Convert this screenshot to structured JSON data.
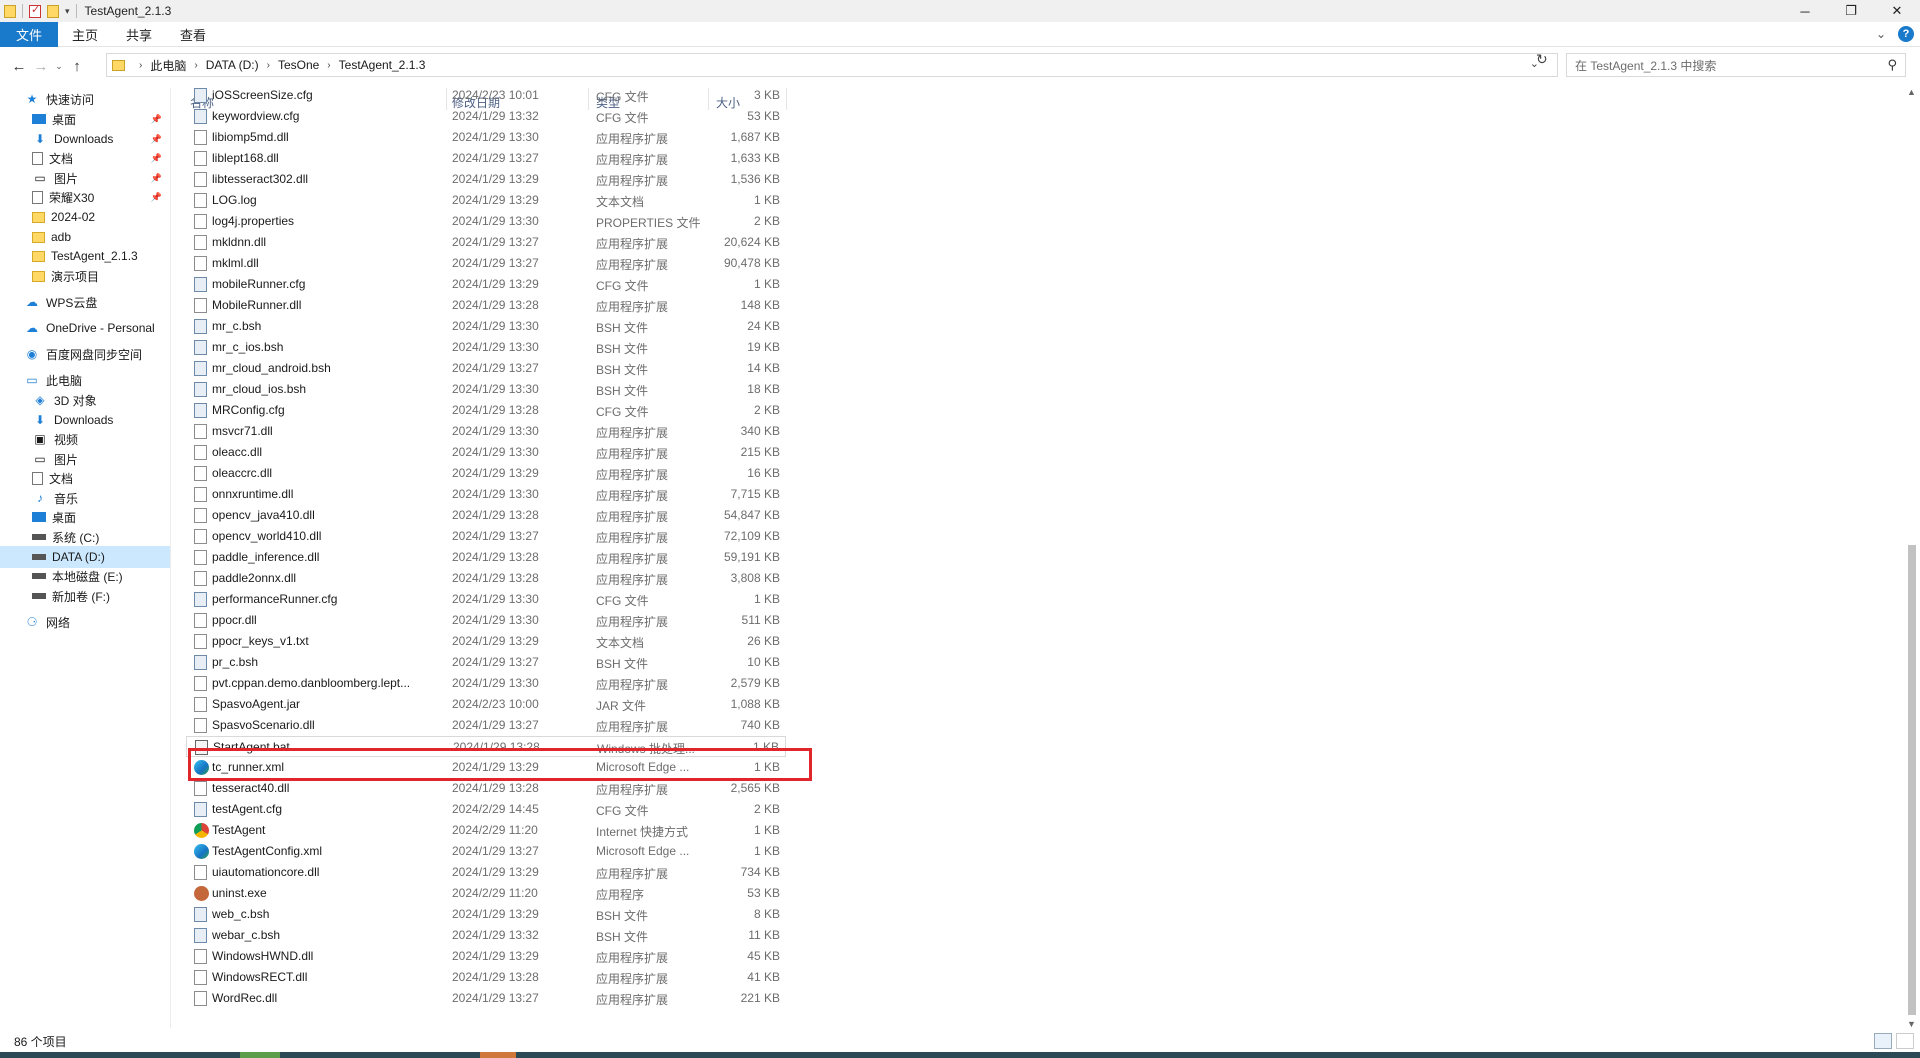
{
  "window": {
    "title": "TestAgent_2.1.3",
    "minimize": "─",
    "maximize": "❐",
    "close": "✕"
  },
  "ribbon": {
    "tabs": [
      "文件",
      "主页",
      "共享",
      "查看"
    ],
    "expand_icon": "chevron-down-icon",
    "help_label": "?"
  },
  "address": {
    "breadcrumbs": [
      "此电脑",
      "DATA (D:)",
      "TesOne",
      "TestAgent_2.1.3"
    ],
    "search_placeholder": "在 TestAgent_2.1.3 中搜索"
  },
  "sidebar": {
    "items": [
      {
        "label": "快速访问",
        "icon": "star-icon",
        "pinned": false
      },
      {
        "label": "桌面",
        "icon": "desktop-icon",
        "pinned": true
      },
      {
        "label": "Downloads",
        "icon": "download-icon",
        "pinned": true
      },
      {
        "label": "文档",
        "icon": "documents-icon",
        "pinned": true
      },
      {
        "label": "图片",
        "icon": "pictures-icon",
        "pinned": true
      },
      {
        "label": "荣耀X30",
        "icon": "phone-icon",
        "pinned": true
      },
      {
        "label": "2024-02",
        "icon": "folder-icon",
        "pinned": false
      },
      {
        "label": "adb",
        "icon": "folder-icon",
        "pinned": false
      },
      {
        "label": "TestAgent_2.1.3",
        "icon": "folder-icon",
        "pinned": false
      },
      {
        "label": "演示项目",
        "icon": "folder-icon",
        "pinned": false
      },
      {
        "label": "WPS云盘",
        "icon": "cloud-icon",
        "pinned": false
      },
      {
        "label": "OneDrive - Personal",
        "icon": "onedrive-icon",
        "pinned": false
      },
      {
        "label": "百度网盘同步空间",
        "icon": "baidu-icon",
        "pinned": false
      },
      {
        "label": "此电脑",
        "icon": "computer-icon",
        "pinned": false
      },
      {
        "label": "3D 对象",
        "icon": "3d-objects-icon",
        "pinned": false
      },
      {
        "label": "Downloads",
        "icon": "download-icon",
        "pinned": false
      },
      {
        "label": "视频",
        "icon": "videos-icon",
        "pinned": false
      },
      {
        "label": "图片",
        "icon": "pictures-icon",
        "pinned": false
      },
      {
        "label": "文档",
        "icon": "documents-icon",
        "pinned": false
      },
      {
        "label": "音乐",
        "icon": "music-icon",
        "pinned": false
      },
      {
        "label": "桌面",
        "icon": "desktop-icon",
        "pinned": false
      },
      {
        "label": "系统 (C:)",
        "icon": "drive-icon",
        "pinned": false
      },
      {
        "label": "DATA (D:)",
        "icon": "drive-icon",
        "pinned": false,
        "selected": true
      },
      {
        "label": "本地磁盘 (E:)",
        "icon": "drive-icon",
        "pinned": false
      },
      {
        "label": "新加卷 (F:)",
        "icon": "drive-icon",
        "pinned": false
      },
      {
        "label": "网络",
        "icon": "network-icon",
        "pinned": false
      }
    ]
  },
  "columns": {
    "name": "名称",
    "date": "修改日期",
    "type": "类型",
    "size": "大小"
  },
  "files": [
    {
      "name": "iOSScreenSize.cfg",
      "date": "2024/2/23 10:01",
      "type": "CFG 文件",
      "size": "3 KB",
      "icon": "cfg"
    },
    {
      "name": "keywordview.cfg",
      "date": "2024/1/29 13:32",
      "type": "CFG 文件",
      "size": "53 KB",
      "icon": "cfg"
    },
    {
      "name": "libiomp5md.dll",
      "date": "2024/1/29 13:30",
      "type": "应用程序扩展",
      "size": "1,687 KB",
      "icon": "file"
    },
    {
      "name": "liblept168.dll",
      "date": "2024/1/29 13:27",
      "type": "应用程序扩展",
      "size": "1,633 KB",
      "icon": "file"
    },
    {
      "name": "libtesseract302.dll",
      "date": "2024/1/29 13:29",
      "type": "应用程序扩展",
      "size": "1,536 KB",
      "icon": "file"
    },
    {
      "name": "LOG.log",
      "date": "2024/1/29 13:29",
      "type": "文本文档",
      "size": "1 KB",
      "icon": "file"
    },
    {
      "name": "log4j.properties",
      "date": "2024/1/29 13:30",
      "type": "PROPERTIES 文件",
      "size": "2 KB",
      "icon": "file"
    },
    {
      "name": "mkldnn.dll",
      "date": "2024/1/29 13:27",
      "type": "应用程序扩展",
      "size": "20,624 KB",
      "icon": "file"
    },
    {
      "name": "mklml.dll",
      "date": "2024/1/29 13:27",
      "type": "应用程序扩展",
      "size": "90,478 KB",
      "icon": "file"
    },
    {
      "name": "mobileRunner.cfg",
      "date": "2024/1/29 13:29",
      "type": "CFG 文件",
      "size": "1 KB",
      "icon": "cfg"
    },
    {
      "name": "MobileRunner.dll",
      "date": "2024/1/29 13:28",
      "type": "应用程序扩展",
      "size": "148 KB",
      "icon": "file"
    },
    {
      "name": "mr_c.bsh",
      "date": "2024/1/29 13:30",
      "type": "BSH 文件",
      "size": "24 KB",
      "icon": "cfg"
    },
    {
      "name": "mr_c_ios.bsh",
      "date": "2024/1/29 13:30",
      "type": "BSH 文件",
      "size": "19 KB",
      "icon": "cfg"
    },
    {
      "name": "mr_cloud_android.bsh",
      "date": "2024/1/29 13:27",
      "type": "BSH 文件",
      "size": "14 KB",
      "icon": "cfg"
    },
    {
      "name": "mr_cloud_ios.bsh",
      "date": "2024/1/29 13:30",
      "type": "BSH 文件",
      "size": "18 KB",
      "icon": "cfg"
    },
    {
      "name": "MRConfig.cfg",
      "date": "2024/1/29 13:28",
      "type": "CFG 文件",
      "size": "2 KB",
      "icon": "cfg"
    },
    {
      "name": "msvcr71.dll",
      "date": "2024/1/29 13:30",
      "type": "应用程序扩展",
      "size": "340 KB",
      "icon": "file"
    },
    {
      "name": "oleacc.dll",
      "date": "2024/1/29 13:30",
      "type": "应用程序扩展",
      "size": "215 KB",
      "icon": "file"
    },
    {
      "name": "oleaccrc.dll",
      "date": "2024/1/29 13:29",
      "type": "应用程序扩展",
      "size": "16 KB",
      "icon": "file"
    },
    {
      "name": "onnxruntime.dll",
      "date": "2024/1/29 13:30",
      "type": "应用程序扩展",
      "size": "7,715 KB",
      "icon": "file"
    },
    {
      "name": "opencv_java410.dll",
      "date": "2024/1/29 13:28",
      "type": "应用程序扩展",
      "size": "54,847 KB",
      "icon": "file"
    },
    {
      "name": "opencv_world410.dll",
      "date": "2024/1/29 13:27",
      "type": "应用程序扩展",
      "size": "72,109 KB",
      "icon": "file"
    },
    {
      "name": "paddle_inference.dll",
      "date": "2024/1/29 13:28",
      "type": "应用程序扩展",
      "size": "59,191 KB",
      "icon": "file"
    },
    {
      "name": "paddle2onnx.dll",
      "date": "2024/1/29 13:28",
      "type": "应用程序扩展",
      "size": "3,808 KB",
      "icon": "file"
    },
    {
      "name": "performanceRunner.cfg",
      "date": "2024/1/29 13:30",
      "type": "CFG 文件",
      "size": "1 KB",
      "icon": "cfg"
    },
    {
      "name": "ppocr.dll",
      "date": "2024/1/29 13:30",
      "type": "应用程序扩展",
      "size": "511 KB",
      "icon": "file"
    },
    {
      "name": "ppocr_keys_v1.txt",
      "date": "2024/1/29 13:29",
      "type": "文本文档",
      "size": "26 KB",
      "icon": "file"
    },
    {
      "name": "pr_c.bsh",
      "date": "2024/1/29 13:27",
      "type": "BSH 文件",
      "size": "10 KB",
      "icon": "cfg"
    },
    {
      "name": "pvt.cppan.demo.danbloomberg.lept...",
      "date": "2024/1/29 13:30",
      "type": "应用程序扩展",
      "size": "2,579 KB",
      "icon": "file"
    },
    {
      "name": "SpasvoAgent.jar",
      "date": "2024/2/23 10:00",
      "type": "JAR 文件",
      "size": "1,088 KB",
      "icon": "file"
    },
    {
      "name": "SpasvoScenario.dll",
      "date": "2024/1/29 13:27",
      "type": "应用程序扩展",
      "size": "740 KB",
      "icon": "file"
    },
    {
      "name": "StartAgent.bat",
      "date": "2024/1/29 13:28",
      "type": "Windows 批处理...",
      "size": "1 KB",
      "icon": "bat",
      "highlighted": true
    },
    {
      "name": "tc_runner.xml",
      "date": "2024/1/29 13:29",
      "type": "Microsoft Edge ...",
      "size": "1 KB",
      "icon": "edge"
    },
    {
      "name": "tesseract40.dll",
      "date": "2024/1/29 13:28",
      "type": "应用程序扩展",
      "size": "2,565 KB",
      "icon": "file"
    },
    {
      "name": "testAgent.cfg",
      "date": "2024/2/29 14:45",
      "type": "CFG 文件",
      "size": "2 KB",
      "icon": "cfg"
    },
    {
      "name": "TestAgent",
      "date": "2024/2/29 11:20",
      "type": "Internet 快捷方式",
      "size": "1 KB",
      "icon": "chrome"
    },
    {
      "name": "TestAgentConfig.xml",
      "date": "2024/1/29 13:27",
      "type": "Microsoft Edge ...",
      "size": "1 KB",
      "icon": "edge"
    },
    {
      "name": "uiautomationcore.dll",
      "date": "2024/1/29 13:29",
      "type": "应用程序扩展",
      "size": "734 KB",
      "icon": "file"
    },
    {
      "name": "uninst.exe",
      "date": "2024/2/29 11:20",
      "type": "应用程序",
      "size": "53 KB",
      "icon": "exe"
    },
    {
      "name": "web_c.bsh",
      "date": "2024/1/29 13:29",
      "type": "BSH 文件",
      "size": "8 KB",
      "icon": "cfg"
    },
    {
      "name": "webar_c.bsh",
      "date": "2024/1/29 13:32",
      "type": "BSH 文件",
      "size": "11 KB",
      "icon": "cfg"
    },
    {
      "name": "WindowsHWND.dll",
      "date": "2024/1/29 13:29",
      "type": "应用程序扩展",
      "size": "45 KB",
      "icon": "file"
    },
    {
      "name": "WindowsRECT.dll",
      "date": "2024/1/29 13:28",
      "type": "应用程序扩展",
      "size": "41 KB",
      "icon": "file"
    },
    {
      "name": "WordRec.dll",
      "date": "2024/1/29 13:27",
      "type": "应用程序扩展",
      "size": "221 KB",
      "icon": "file"
    }
  ],
  "status": {
    "item_count": "86 个项目"
  },
  "colors": {
    "accent": "#1979ca",
    "highlight_box": "#e0262b",
    "selected_bg": "#cce8ff"
  }
}
